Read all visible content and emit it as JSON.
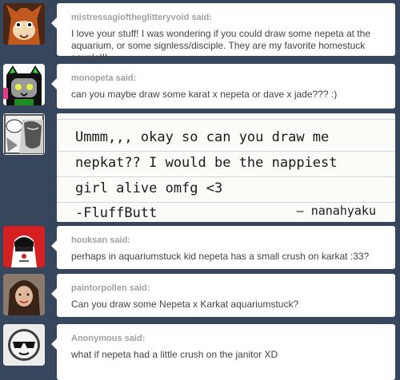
{
  "posts": [
    {
      "asker": "mistressagioftheglitteryvoid said:",
      "text": "I love your stuff! I was wondering if you could draw some nepeta at the aquarium, or some signless/disciple. They are my favorite homestuck couple!!!",
      "avatar_icon": "cartoon-cat-face-avatar"
    },
    {
      "asker": "monopeta said:",
      "text": "can you maybe draw some karat x nepeta or dave x jade??? :)",
      "avatar_icon": "green-cat-girl-avatar"
    },
    {
      "handwritten_lines": [
        "Ummm,,, okay so can you draw me",
        "nepkat?? I would be the nappiest",
        "girl alive omfg <3",
        "-FluffButt"
      ],
      "signature": "— nanahyaku",
      "avatar_icon": "manga-panel-avatar"
    },
    {
      "asker": "houksan said:",
      "text": "perhaps in aquariumstuck kid nepeta has a small crush on karkat :33?",
      "avatar_icon": "red-troll-avatar"
    },
    {
      "asker": "paintorpollen said:",
      "text": "Can you draw some Nepeta x Karkat aquariumstuck?",
      "avatar_icon": "photo-girl-avatar"
    },
    {
      "asker": "Anonymous said:",
      "text": "what if nepeta had a little crush on the janitor XD",
      "avatar_icon": "sunglasses-anonymous-avatar"
    }
  ],
  "colors": {
    "dashboard_bg": "#36465d",
    "card_bg": "#ffffff",
    "asker_text": "#a0a0a0",
    "body_text": "#444444"
  }
}
